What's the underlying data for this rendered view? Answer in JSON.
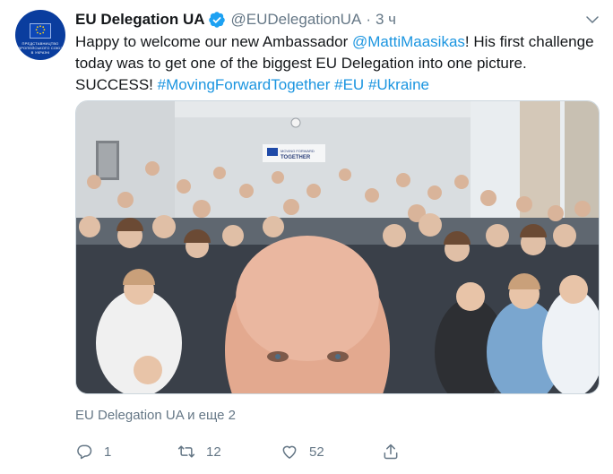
{
  "tweet": {
    "display_name": "EU Delegation UA",
    "handle": "@EUDelegationUA",
    "separator": "·",
    "time": "3 ч",
    "text": {
      "p1": "Happy to welcome our new Ambassador ",
      "mention": "@MattiMaasikas",
      "p2": "! His first challenge today was to get one of the biggest EU Delegation into one picture. SUCCESS! ",
      "hashtag1": "#MovingForwardTogether",
      "hashtag2": "#EU",
      "hashtag3": "#Ukraine"
    },
    "tagged": "EU Delegation UA и еще 2",
    "media": {
      "banner_line1": "MOVING FORWARD",
      "banner_line2": "TOGETHER"
    },
    "avatar_text": "ПРЕДСТАВНИЦТВО ЄВРОПЕЙСЬКОГО СОЮЗУ В УКРАЇНІ"
  },
  "actions": {
    "replies": "1",
    "retweets": "12",
    "likes": "52"
  },
  "colors": {
    "link": "#1b95e0",
    "verified": "#1da1f2",
    "muted": "#657786",
    "eu_blue": "#0a3d9e"
  },
  "icons": [
    "verified-icon",
    "chevron-down-icon",
    "reply-icon",
    "retweet-icon",
    "like-icon",
    "share-icon"
  ]
}
